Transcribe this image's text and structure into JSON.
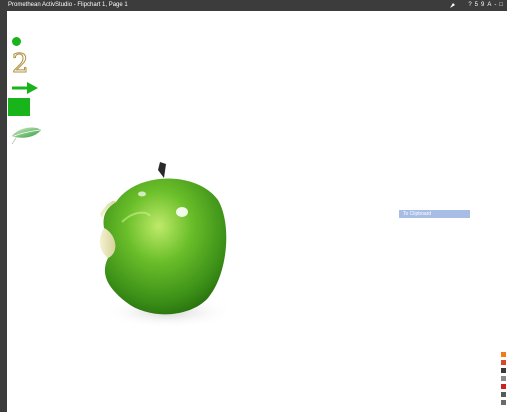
{
  "window": {
    "title": "Promethean ActivStudio - Flipchart 1, Page 1",
    "controls": [
      "?",
      "5",
      "9",
      "A",
      "-",
      "□"
    ]
  },
  "toolbar": {
    "number_glyph": "2"
  },
  "flip_button": {
    "label": "To Clipboard"
  },
  "colors": {
    "frame": "#3c3c3c",
    "accent_green": "#18b41a",
    "button_blue": "#a8bde6"
  },
  "icons": [
    "circle-shape-icon",
    "number-two-icon",
    "arrow-right-icon",
    "rectangle-shape-icon",
    "leaf-icon",
    "apple-image"
  ]
}
